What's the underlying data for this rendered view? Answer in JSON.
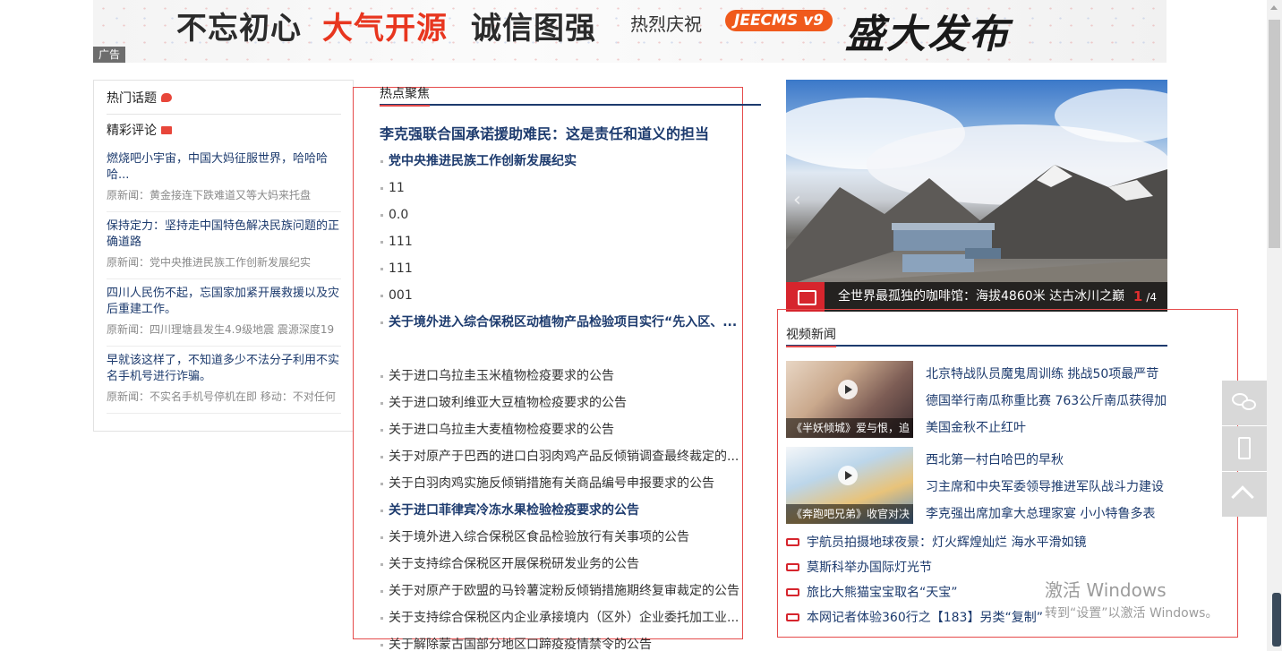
{
  "banner": {
    "slogan_1": "不忘初心",
    "slogan_2": "大气开源",
    "slogan_3": "诚信图强",
    "celebrate": "热烈庆祝",
    "version": "JEECMS v9",
    "launch": "盛大发布",
    "ad_label": "广告"
  },
  "sidebar": {
    "hot_topics_label": "热门话题",
    "comments_label": "精彩评论",
    "comments": [
      {
        "title": "燃烧吧小宇宙，中国大妈征服世界，哈哈哈哈...",
        "source": "原新闻：黄金接连下跌难道又等大妈来托盘"
      },
      {
        "title": "保持定力：坚持走中国特色解决民族问题的正确道路",
        "source": "原新闻：党中央推进民族工作创新发展纪实"
      },
      {
        "title": "四川人民伤不起，忘国家加紧开展救援以及灾后重建工作。",
        "source": "原新闻：四川理塘县发生4.9级地震 震源深度19"
      },
      {
        "title": "早就该这样了，不知道多少不法分子利用不实名手机号进行诈骗。",
        "source": "原新闻：不实名手机号停机在即 移动：不对任何"
      }
    ]
  },
  "hot_focus": {
    "section_label": "热点聚焦",
    "headline": "李克强联合国承诺援助难民：这是责任和道义的担当",
    "items": [
      {
        "text": "党中央推进民族工作创新发展纪实",
        "bold": true
      },
      {
        "text": "11",
        "bold": false
      },
      {
        "text": "0.0",
        "bold": false
      },
      {
        "text": "111",
        "bold": false
      },
      {
        "text": "111",
        "bold": false
      },
      {
        "text": "001",
        "bold": false
      },
      {
        "text": "关于境外进入综合保税区动植物产品检验项目实行“先入区、...",
        "bold": true
      },
      {
        "text": "关于进口乌拉圭玉米植物检疫要求的公告",
        "bold": false
      },
      {
        "text": "关于进口玻利维亚大豆植物检疫要求的公告",
        "bold": false
      },
      {
        "text": "关于进口乌拉圭大麦植物检疫要求的公告",
        "bold": false
      },
      {
        "text": "关于对原产于巴西的进口白羽肉鸡产品反倾销调查最终裁定的...",
        "bold": false
      },
      {
        "text": "关于白羽肉鸡实施反倾销措施有关商品编号申报要求的公告",
        "bold": false
      },
      {
        "text": "关于进口菲律宾冷冻水果检验检疫要求的公告",
        "bold": true
      },
      {
        "text": "关于境外进入综合保税区食品检验放行有关事项的公告",
        "bold": false
      },
      {
        "text": "关于支持综合保税区开展保税研发业务的公告",
        "bold": false
      },
      {
        "text": "关于对原产于欧盟的马铃薯淀粉反倾销措施期终复审裁定的公告",
        "bold": false
      },
      {
        "text": "关于支持综合保税区内企业承接境内（区外）企业委托加工业...",
        "bold": false
      },
      {
        "text": "关于解除蒙古国部分地区口蹄疫疫情禁令的公告",
        "bold": false
      }
    ]
  },
  "slider": {
    "caption": "全世界最孤独的咖啡馆：海拔4860米 达古冰川之巅",
    "current": "1",
    "total": "/4",
    "prev_arrow": "‹"
  },
  "video_news": {
    "section_label": "视频新闻",
    "thumbs": [
      {
        "caption": "《半妖倾城》爱与恨，追"
      },
      {
        "caption": "《奔跑吧兄弟》收官对决"
      }
    ],
    "group1": [
      "北京特战队员魔鬼周训练 挑战50项最严苛",
      "德国举行南瓜称重比赛 763公斤南瓜获得加",
      "美国金秋不止红叶"
    ],
    "group2": [
      "西北第一村白哈巴的早秋",
      "习主席和中央军委领导推进军队战斗力建设",
      "李克强出席加拿大总理家宴 小小特鲁多表"
    ],
    "bottom": [
      "宇航员拍摄地球夜景：灯火辉煌灿烂 海水平滑如镜",
      "莫斯科举办国际灯光节",
      "旅比大熊猫宝宝取名“天宝”",
      "本网记者体验360行之【183】另类“复制”"
    ]
  },
  "watermark": {
    "line1": "激活 Windows",
    "line2": "转到“设置”以激活 Windows。"
  },
  "colors": {
    "accent_red": "#e54b4b",
    "link_blue": "#1d3b6e",
    "brand_orange": "#f05a1c"
  },
  "icons": {
    "tool_1": "wechat-icon",
    "tool_2": "mobile-icon",
    "tool_3": "back-to-top-icon"
  }
}
